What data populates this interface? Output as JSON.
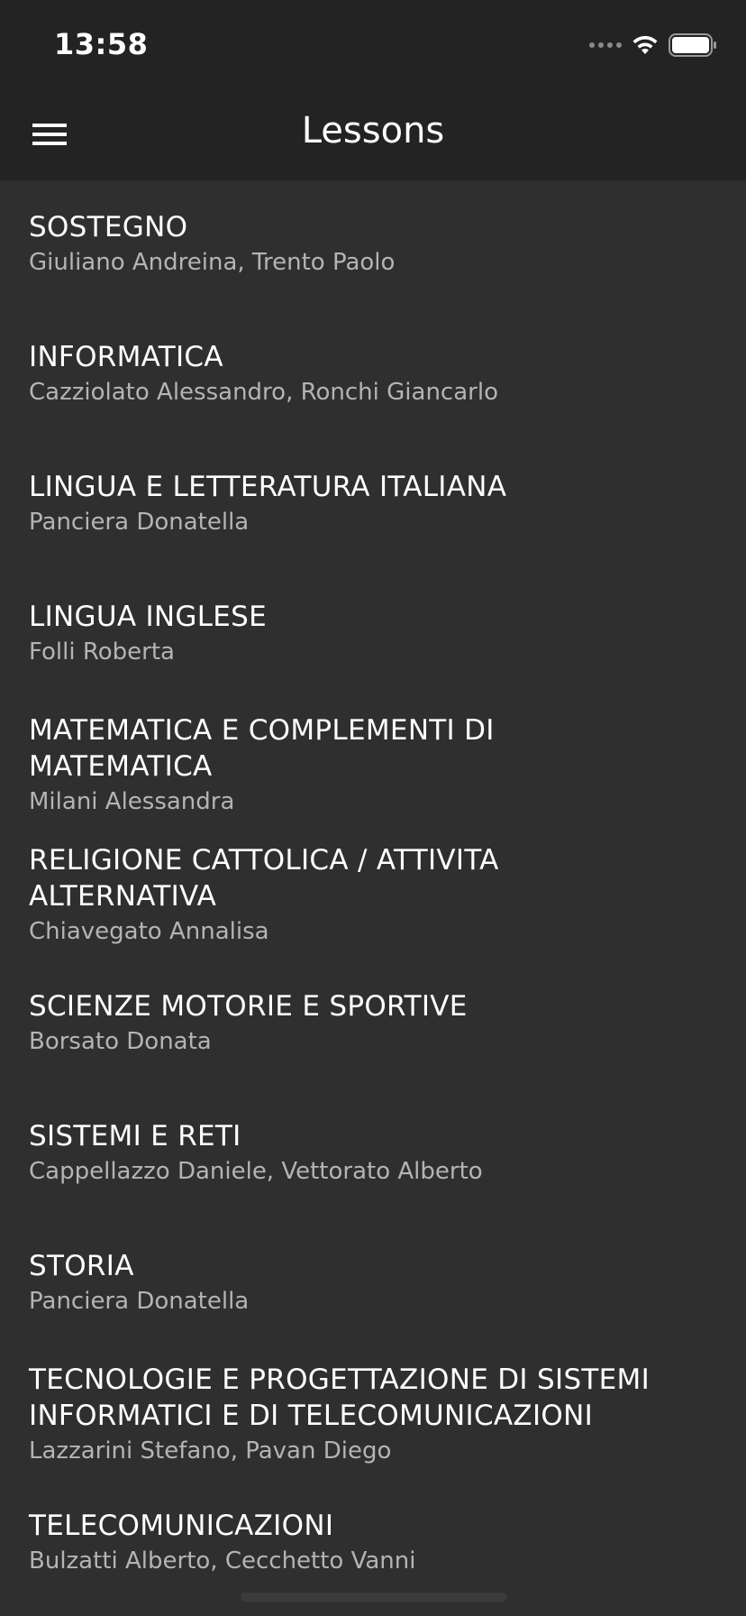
{
  "status_bar": {
    "time": "13:58"
  },
  "nav": {
    "title": "Lessons",
    "menu_icon": "hamburger-menu-icon"
  },
  "lessons": [
    {
      "title": "SOSTEGNO",
      "teachers": "Giuliano Andreina, Trento Paolo"
    },
    {
      "title": "INFORMATICA",
      "teachers": "Cazziolato Alessandro, Ronchi Giancarlo"
    },
    {
      "title": "LINGUA E LETTERATURA ITALIANA",
      "teachers": "Panciera Donatella"
    },
    {
      "title": "LINGUA INGLESE",
      "teachers": "Folli Roberta"
    },
    {
      "title": "MATEMATICA E COMPLEMENTI DI MATEMATICA",
      "teachers": "Milani Alessandra"
    },
    {
      "title": "RELIGIONE CATTOLICA / ATTIVITA ALTERNATIVA",
      "teachers": "Chiavegato Annalisa"
    },
    {
      "title": "SCIENZE MOTORIE E SPORTIVE",
      "teachers": "Borsato Donata"
    },
    {
      "title": "SISTEMI E RETI",
      "teachers": "Cappellazzo Daniele, Vettorato Alberto"
    },
    {
      "title": "STORIA",
      "teachers": "Panciera Donatella"
    },
    {
      "title": "TECNOLOGIE E PROGETTAZIONE DI SISTEMI INFORMATICI E DI TELECOMUNICAZIONI",
      "teachers": "Lazzarini Stefano, Pavan Diego"
    },
    {
      "title": "TELECOMUNICAZIONI",
      "teachers": "Bulzatti Alberto, Cecchetto Vanni"
    }
  ],
  "colors": {
    "background": "#2f2f2f",
    "header": "#232323",
    "title_text": "#ffffff",
    "teacher_text": "#b4b4b4"
  }
}
